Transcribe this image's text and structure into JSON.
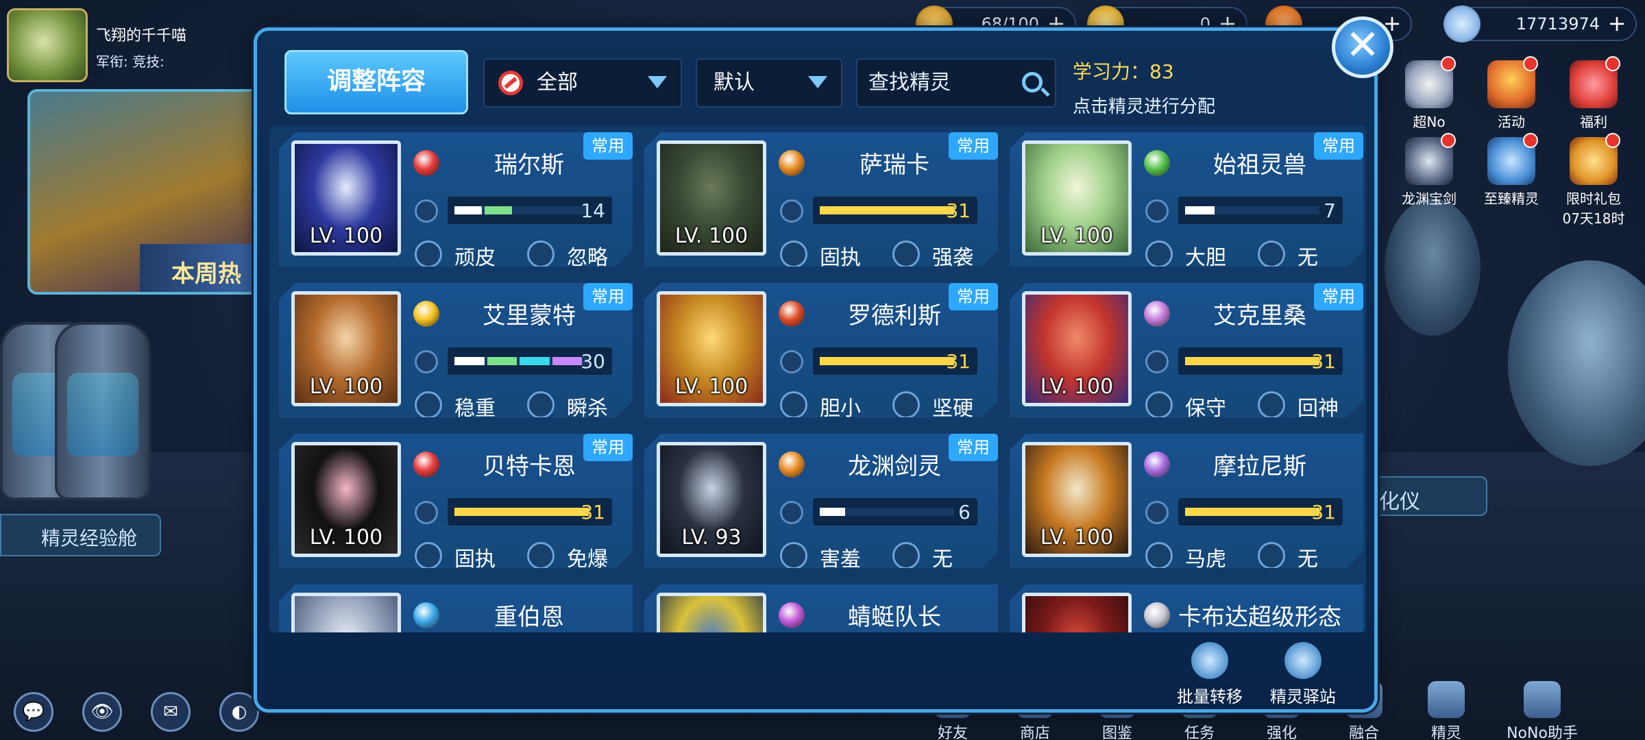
{
  "player": {
    "name": "飞翔的千千喵",
    "ranks": "军衔:  竞技:"
  },
  "resources": [
    {
      "value": "68/100",
      "color": "#d9a43a"
    },
    {
      "value": "0",
      "color": "#e0b23a"
    },
    {
      "value": "",
      "color": "#e07a2a"
    },
    {
      "value": "17713974",
      "color": "#8fb8e8"
    }
  ],
  "hot": {
    "label": "本周热点"
  },
  "scene_labels": {
    "exp_cabin": "精灵经验舱",
    "incubator": "孵化仪"
  },
  "right_menu": [
    {
      "label": "超No"
    },
    {
      "label": "活动"
    },
    {
      "label": "福利"
    },
    {
      "label": "龙渊宝剑"
    },
    {
      "label": "至臻精灵"
    },
    {
      "label": "限时礼包",
      "sub": "07天18时"
    }
  ],
  "bottom_nav": [
    "好友",
    "商店",
    "图鉴",
    "任务",
    "强化",
    "融合",
    "精灵",
    "NoNo助手"
  ],
  "modal": {
    "adjust_label": "调整阵容",
    "filter_value": "全部",
    "sort_value": "默认",
    "search_placeholder": "查找精灵",
    "learn_power_label": "学习力：83",
    "learn_hint": "点击精灵进行分配",
    "common_tag": "常用",
    "actions": {
      "batch": "批量转移",
      "station": "精灵驿站"
    }
  },
  "cards": [
    {
      "name": "瑞尔斯",
      "level": "LV. 100",
      "stat": "14",
      "fill": 0.45,
      "multi": [
        "#ffffff",
        "#7ee08a"
      ],
      "t1": "顽皮",
      "t2": "忽略",
      "common": true,
      "attr": "#e63a3a",
      "portrait": [
        "#e7ecff",
        "#2d3a9e",
        "#0e1440"
      ]
    },
    {
      "name": "萨瑞卡",
      "level": "LV. 100",
      "stat": "31",
      "fill": 1,
      "t1": "固执",
      "t2": "强袭",
      "common": true,
      "attr": "#e88a22",
      "portrait": [
        "#6a7a58",
        "#3a4a36",
        "#1d2418"
      ]
    },
    {
      "name": "始祖灵兽",
      "level": "LV. 100",
      "stat": "7",
      "fill": 0.22,
      "t1": "大胆",
      "t2": "无",
      "common": true,
      "attr": "#55c24a",
      "portrait": [
        "#f1f5d8",
        "#9fd08a",
        "#3b6a3a"
      ]
    },
    {
      "name": "艾里蒙特",
      "level": "LV. 100",
      "stat": "30",
      "fill": 0.97,
      "multi": [
        "#ffffff",
        "#7ee08a",
        "#38d8e8",
        "#c889ff"
      ],
      "t1": "稳重",
      "t2": "瞬杀",
      "common": true,
      "attr": "#f5c11e",
      "portrait": [
        "#f5d4a8",
        "#b46b2e",
        "#5a2f12"
      ]
    },
    {
      "name": "罗德利斯",
      "level": "LV. 100",
      "stat": "31",
      "fill": 1,
      "t1": "胆小",
      "t2": "坚硬",
      "common": true,
      "attr": "#e04a26",
      "portrait": [
        "#ffd977",
        "#c78a22",
        "#8a2a1a"
      ]
    },
    {
      "name": "艾克里桑",
      "level": "LV. 100",
      "stat": "31",
      "fill": 1,
      "t1": "保守",
      "t2": "回神",
      "common": true,
      "attr": "#c37ad9",
      "portrait": [
        "#f08a6a",
        "#c2352c",
        "#3a2a7a"
      ]
    },
    {
      "name": "贝特卡恩",
      "level": "LV. 100",
      "stat": "31",
      "fill": 1,
      "t1": "固执",
      "t2": "免爆",
      "common": true,
      "attr": "#e63a3a",
      "portrait": [
        "#f7b7c8",
        "#111111",
        "#2a2a2a"
      ]
    },
    {
      "name": "龙渊剑灵",
      "level": "LV. 93",
      "stat": "6",
      "fill": 0.19,
      "t1": "害羞",
      "t2": "无",
      "common": true,
      "attr": "#e88a22",
      "portrait": [
        "#c9d2e6",
        "#2a3242",
        "#0f141d"
      ]
    },
    {
      "name": "摩拉尼斯",
      "level": "LV. 100",
      "stat": "31",
      "fill": 1,
      "t1": "马虎",
      "t2": "无",
      "common": false,
      "attr": "#a56ae0",
      "portrait": [
        "#f2e8c8",
        "#c77a22",
        "#2a1a10"
      ]
    },
    {
      "name": "重伯恩",
      "level": "",
      "stat": "",
      "fill": 0,
      "t1": "",
      "t2": "",
      "common": false,
      "attr": "#3aa9e8",
      "portrait": [
        "#e8eef8",
        "#9aa6bd",
        "#3a4a6a"
      ]
    },
    {
      "name": "蜻蜓队长",
      "level": "",
      "stat": "",
      "fill": 0,
      "t1": "",
      "t2": "",
      "common": false,
      "attr": "#c25ad9",
      "portrait": [
        "#4a7abf",
        "#d9c23a",
        "#1a2a4a"
      ]
    },
    {
      "name": "卡布达超级形态",
      "level": "",
      "stat": "",
      "fill": 0,
      "t1": "",
      "t2": "",
      "common": false,
      "attr": "#c7c7d2",
      "portrait": [
        "#d94a3a",
        "#7a1a1a",
        "#2a0a0a"
      ]
    }
  ]
}
